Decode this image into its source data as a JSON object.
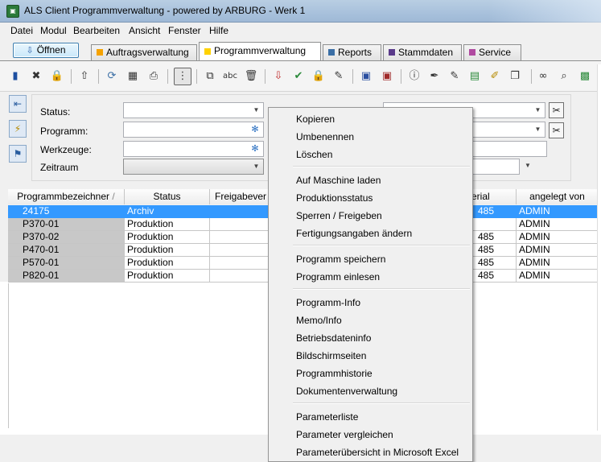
{
  "window": {
    "title": "ALS Client Programmverwaltung - powered by ARBURG - Werk 1",
    "icon": "als-app-icon"
  },
  "menu": [
    "Datei",
    "Modul",
    "Bearbeiten",
    "Ansicht",
    "Fenster",
    "Hilfe"
  ],
  "open_button": {
    "label": "Öffnen",
    "icon": "open-arrow-icon"
  },
  "tabs": [
    {
      "label": "Auftragsverwaltung",
      "color": "#f5a200",
      "active": false
    },
    {
      "label": "Programmverwaltung",
      "color": "#ffd200",
      "active": true
    },
    {
      "label": "Reports",
      "color": "#3a6ea5",
      "active": false
    },
    {
      "label": "Stammdaten",
      "color": "#5a3a8a",
      "active": false
    },
    {
      "label": "Service",
      "color": "#b04aa0",
      "active": false
    }
  ],
  "filter": {
    "status_label": "Status:",
    "programm_label": "Programm:",
    "werkzeuge_label": "Werkzeuge:",
    "zeitraum_label": "Zeitraum"
  },
  "table": {
    "columns": [
      "Programmbezeichner",
      "Status",
      "Freigabever",
      "erial",
      "angelegt von"
    ],
    "sort_indicator": "/",
    "rows": [
      {
        "id": "24175",
        "status": "Archiv",
        "material": "485",
        "user": "ADMIN",
        "selected": true
      },
      {
        "id": "P370-01",
        "status": "Produktion",
        "material": "",
        "user": "ADMIN",
        "selected": false
      },
      {
        "id": "P370-02",
        "status": "Produktion",
        "material": "485",
        "user": "ADMIN",
        "selected": false
      },
      {
        "id": "P470-01",
        "status": "Produktion",
        "material": "485",
        "user": "ADMIN",
        "selected": false
      },
      {
        "id": "P570-01",
        "status": "Produktion",
        "material": "485",
        "user": "ADMIN",
        "selected": false
      },
      {
        "id": "P820-01",
        "status": "Produktion",
        "material": "485",
        "user": "ADMIN",
        "selected": false
      }
    ]
  },
  "context_menu": {
    "groups": [
      [
        "Kopieren",
        "Umbenennen",
        "Löschen"
      ],
      [
        "Auf Maschine laden",
        "Produktionsstatus",
        "Sperren / Freigeben",
        "Fertigungsangaben ändern"
      ],
      [
        "Programm speichern",
        "Programm einlesen"
      ],
      [
        "Programm-Info",
        "Memo/Info",
        "Betriebsdateninfo",
        "Bildschirmseiten",
        "Programmhistorie",
        "Dokumentenverwaltung"
      ],
      [
        "Parameterliste",
        "Parameter vergleichen",
        "Parameterübersicht in Microsoft Excel"
      ]
    ]
  }
}
